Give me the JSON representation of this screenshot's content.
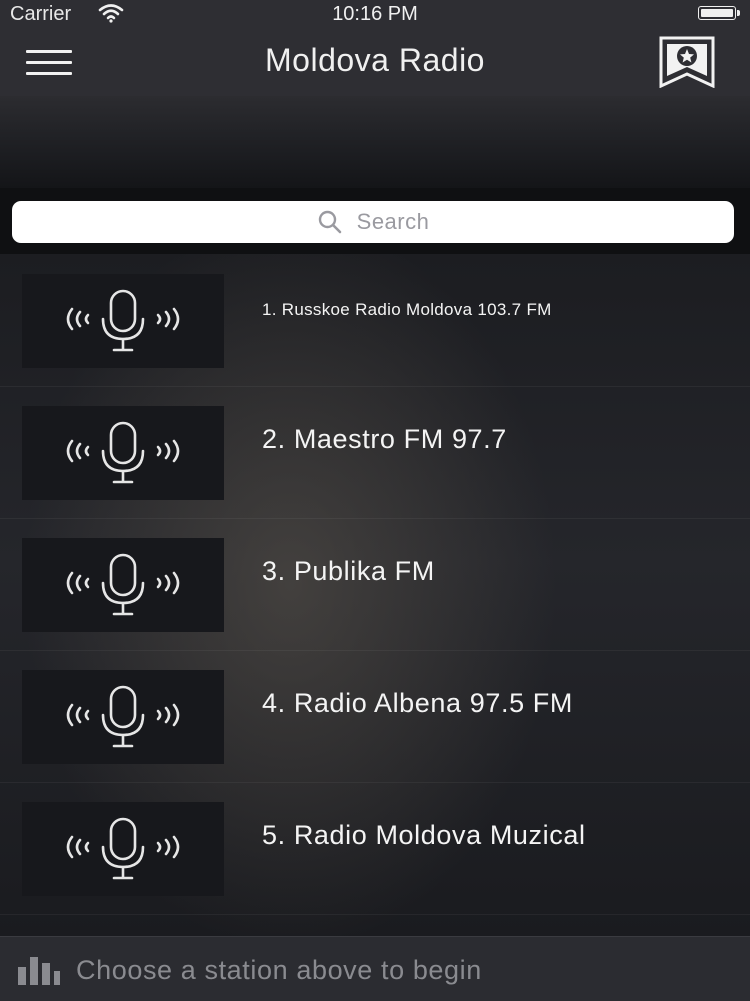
{
  "status_bar": {
    "carrier": "Carrier",
    "time": "10:16 PM",
    "icons": [
      "wifi-icon",
      "battery-icon"
    ]
  },
  "nav_bar": {
    "title": "Moldova Radio",
    "left_icon": "hamburger-menu-icon",
    "right_icon": "star-badge-icon"
  },
  "search": {
    "placeholder": "Search",
    "icon": "search-icon"
  },
  "stations": [
    {
      "label": "1. Russkoe Radio Moldova 103.7 FM",
      "icon": "microphone-broadcast-icon"
    },
    {
      "label": "2. Maestro FM 97.7",
      "icon": "microphone-broadcast-icon"
    },
    {
      "label": "3. Publika FM",
      "icon": "microphone-broadcast-icon"
    },
    {
      "label": "4. Radio Albena 97.5 FM",
      "icon": "microphone-broadcast-icon"
    },
    {
      "label": "5. Radio Moldova Muzical",
      "icon": "microphone-broadcast-icon"
    }
  ],
  "now_playing": {
    "text": "Choose a station above to begin",
    "icon": "equalizer-bars-icon"
  },
  "colors": {
    "bar_background": "#2e2e33",
    "list_background": "#1c1d21",
    "thumb_background": "#17181c",
    "text": "#f4f4f4",
    "muted_text": "#8a8b90"
  }
}
